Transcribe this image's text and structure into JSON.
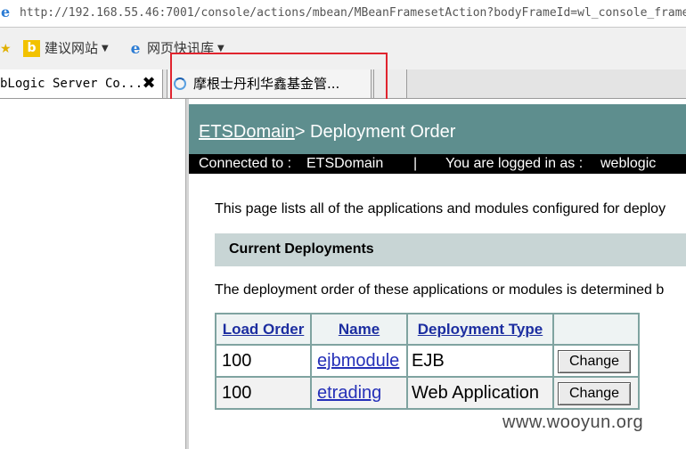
{
  "browser": {
    "address_url": "http://192.168.55.46:7001/console/actions/mbean/MBeanFramesetAction?bodyFrameId=wl_console_frame",
    "favorites": [
      {
        "label": "建议网站"
      },
      {
        "label": "网页快讯库"
      }
    ],
    "tabs": [
      {
        "title": "bLogic Server Co...",
        "close": "✖"
      },
      {
        "title": "摩根士丹利华鑫基金管..."
      }
    ]
  },
  "page": {
    "domain_link": "ETSDomain",
    "title_suffix": "> Deployment Order",
    "connected_label": "Connected to :",
    "connected_value": "ETSDomain",
    "separator": "|",
    "logged_in_label": "You are logged in as :",
    "logged_in_value": "weblogic",
    "intro_text": "This page lists all of the applications and modules configured for deploy",
    "section_title": "Current Deployments",
    "order_note": "The deployment order of these applications or modules is determined b"
  },
  "table": {
    "headers": [
      "Load Order",
      "Name",
      "Deployment Type"
    ],
    "rows": [
      {
        "load_order": "100",
        "name": "ejbmodule",
        "type": "EJB",
        "action": "Change"
      },
      {
        "load_order": "100",
        "name": "etrading",
        "type": "Web Application",
        "action": "Change"
      }
    ]
  },
  "watermark": "www.wooyun.org",
  "colors": {
    "banner": "#5e8e8e",
    "section": "#c8d5d5",
    "table_border": "#7fa3a0",
    "highlight": "#e0242e"
  }
}
